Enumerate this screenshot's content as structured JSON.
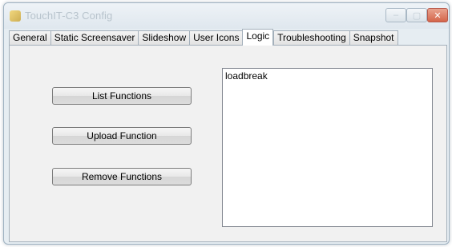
{
  "window": {
    "title": "TouchIT-C3 Config",
    "controls": {
      "minimize": "–",
      "maximize": "▢",
      "close": "✕"
    }
  },
  "tabs": [
    {
      "label": "General",
      "active": false
    },
    {
      "label": "Static Screensaver",
      "active": false
    },
    {
      "label": "Slideshow",
      "active": false
    },
    {
      "label": "User Icons",
      "active": false
    },
    {
      "label": "Logic",
      "active": true
    },
    {
      "label": "Troubleshooting",
      "active": false
    },
    {
      "label": "Snapshot",
      "active": false
    }
  ],
  "logic_panel": {
    "buttons": {
      "list_functions": "List Functions",
      "upload_function": "Upload Function",
      "remove_functions": "Remove Functions"
    },
    "functions_list": [
      "loadbreak"
    ]
  },
  "icons": {
    "app": "app-icon",
    "minimize": "minimize-icon",
    "maximize": "maximize-icon",
    "close": "close-icon"
  }
}
